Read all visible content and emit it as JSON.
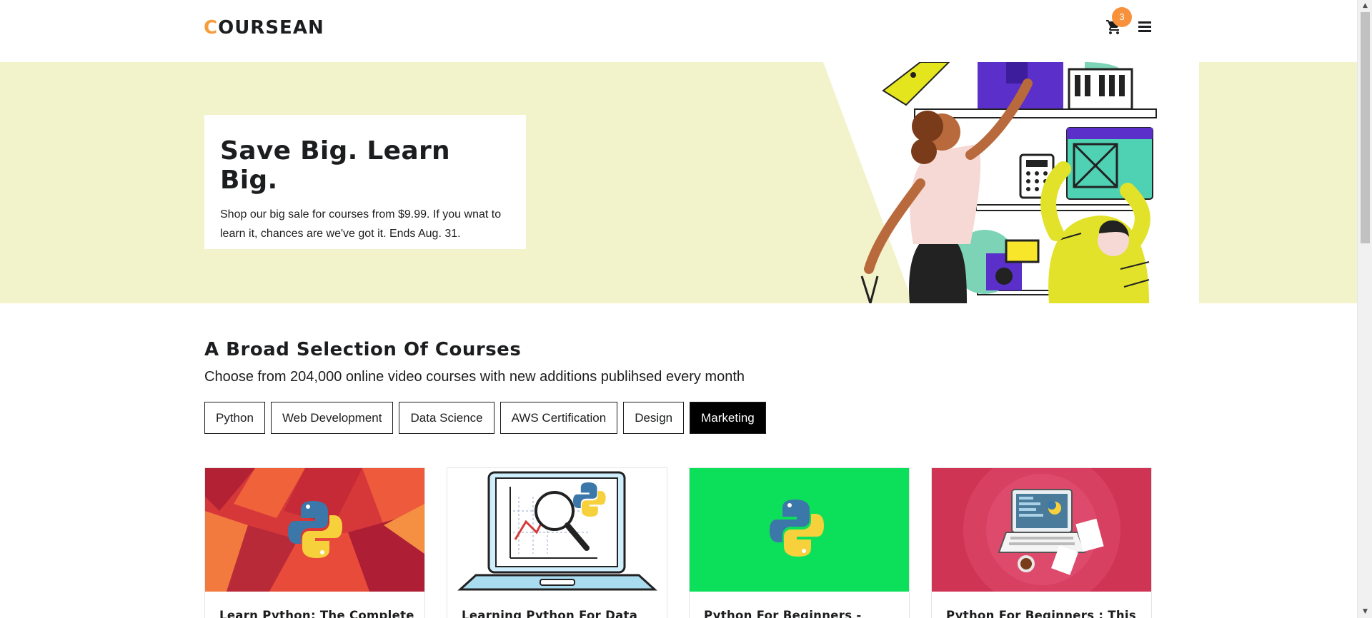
{
  "header": {
    "logo_first": "C",
    "logo_rest": "OURSEAN",
    "cart_count": "3",
    "cart_icon": "shopping-cart-icon",
    "menu_icon": "hamburger-menu-icon"
  },
  "hero": {
    "title": "Save Big. Learn Big.",
    "text": "Shop our big sale for courses from $9.99. If you wnat to learn it, chances are we've got it. Ends Aug. 31."
  },
  "courses_section": {
    "title": "A Broad Selection Of Courses",
    "subtitle": "Choose from 204,000 online video courses with new additions publihsed every month",
    "tabs": [
      {
        "label": "Python",
        "active": false
      },
      {
        "label": "Web Development",
        "active": false
      },
      {
        "label": "Data Science",
        "active": false
      },
      {
        "label": "AWS Certification",
        "active": false
      },
      {
        "label": "Design",
        "active": false
      },
      {
        "label": "Marketing",
        "active": true
      }
    ]
  },
  "courses": [
    {
      "title": "Learn Python: The Complete"
    },
    {
      "title": "Learning Python For Data"
    },
    {
      "title": "Python For Beginners -"
    },
    {
      "title": "Python For Beginners : This"
    }
  ],
  "colors": {
    "accent": "#f69c3c",
    "hero_bg": "#f3f3cb",
    "badge": "#f7913b"
  }
}
